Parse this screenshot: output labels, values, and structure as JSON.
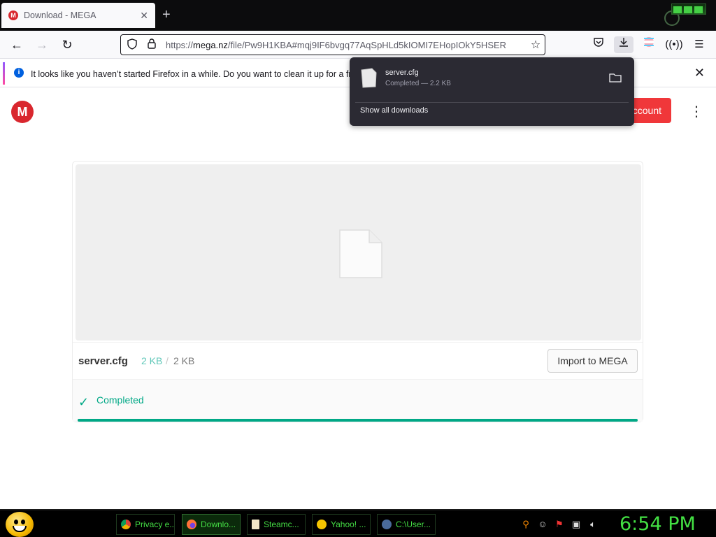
{
  "browser": {
    "tab": {
      "title": "Download - MEGA",
      "favicon_letter": "M"
    },
    "url": {
      "host": "mega.nz",
      "prefix": "https://",
      "rest": "/file/Pw9H1KBA#mqj9IF6bvgq77AqSpHLd5kIOMI7EHopIOkY5HSER"
    },
    "notification": {
      "message": "It looks like you haven’t started Firefox in a while. Do you want to clean it up for a fresh"
    }
  },
  "downloads_panel": {
    "file_name": "server.cfg",
    "file_meta": "Completed — 2.2 KB",
    "show_all_label": "Show all downloads"
  },
  "mega": {
    "logo_letter": "M",
    "create_account_label": "ccount",
    "file_name": "server.cfg",
    "downloaded": "2 KB",
    "separator": "/",
    "total": "2 KB",
    "import_label": "Import to MEGA",
    "status_label": "Completed",
    "progress_fraction": 1.0
  },
  "taskbar": {
    "tasks": [
      {
        "label": "Privacy e...",
        "icon": "chrome-icon"
      },
      {
        "label": "Downlo...",
        "icon": "firefox-icon"
      },
      {
        "label": "Steamc...",
        "icon": "document-icon"
      },
      {
        "label": "Yahoo! ...",
        "icon": "yahoo-smiley-icon"
      },
      {
        "label": "C:\\User...",
        "icon": "steam-icon"
      }
    ],
    "clock": "6:54 PM"
  },
  "colors": {
    "mega_red": "#d9272e",
    "success_green": "#00a886",
    "taskbar_text": "#44dd44"
  }
}
